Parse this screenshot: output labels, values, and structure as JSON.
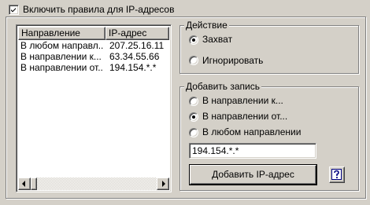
{
  "enable_rules": {
    "label": "Включить правила для IP-адресов",
    "checked": true
  },
  "list": {
    "columns": [
      "Направление",
      "IP-адрес"
    ],
    "rows": [
      {
        "direction": "В любом направл...",
        "ip": "207.25.16.11"
      },
      {
        "direction": "В направлении к...",
        "ip": "63.34.55.66"
      },
      {
        "direction": "В направлении от...",
        "ip": "194.154.*.*"
      }
    ]
  },
  "action_group": {
    "title": "Действие",
    "options": [
      {
        "label": "Захват",
        "selected": true
      },
      {
        "label": "Игнорировать",
        "selected": false
      }
    ]
  },
  "add_group": {
    "title": "Добавить запись",
    "options": [
      {
        "label": "В направлении к...",
        "selected": false
      },
      {
        "label": "В направлении от...",
        "selected": true
      },
      {
        "label": "В любом направлении",
        "selected": false
      }
    ],
    "ip_value": "194.154.*.*",
    "add_button_label": "Добавить IP-адрес",
    "help_icon": "help-question-icon"
  },
  "colors": {
    "face": "#d4d0c8",
    "shadow": "#808080",
    "help_icon_blue": "#000080"
  }
}
